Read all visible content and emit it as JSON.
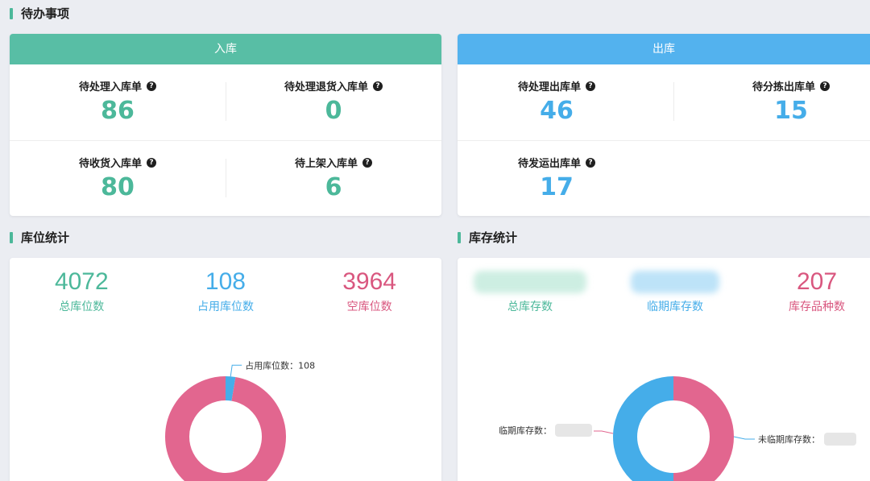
{
  "sections": {
    "todo": "待办事项",
    "location": "库位统计",
    "inventory": "库存统计"
  },
  "inbound": {
    "header": "入库",
    "items": [
      {
        "label": "待处理入库单",
        "value": "86"
      },
      {
        "label": "待处理退货入库单",
        "value": "0"
      },
      {
        "label": "待收货入库单",
        "value": "80"
      },
      {
        "label": "待上架入库单",
        "value": "6"
      }
    ]
  },
  "outbound": {
    "header": "出库",
    "items": [
      {
        "label": "待处理出库单",
        "value": "46"
      },
      {
        "label": "待分拣出库单",
        "value": "15"
      },
      {
        "label": "待发运出库单",
        "value": "17"
      }
    ]
  },
  "location_stats": {
    "items": [
      {
        "label": "总库位数",
        "value": "4072"
      },
      {
        "label": "占用库位数",
        "value": "108"
      },
      {
        "label": "空库位数",
        "value": "3964"
      }
    ]
  },
  "inventory_stats": {
    "items": [
      {
        "label": "总库存数",
        "value": ""
      },
      {
        "label": "临期库存数",
        "value": ""
      },
      {
        "label": "库存品种数",
        "value": "207"
      }
    ]
  },
  "colors": {
    "green": "#4cb89a",
    "blue": "#45ade9",
    "pink": "#e2668f"
  },
  "chart_data": [
    {
      "type": "pie",
      "categories": [
        "占用库位数",
        "空库位数"
      ],
      "values": [
        108,
        3964
      ],
      "annotations": [
        "占用库位数：108"
      ]
    },
    {
      "type": "pie",
      "categories": [
        "临期库存数",
        "未临期库存数"
      ],
      "values": [
        50,
        50
      ],
      "annotations": [
        "临期库存数：",
        "未临期库存数："
      ]
    }
  ]
}
